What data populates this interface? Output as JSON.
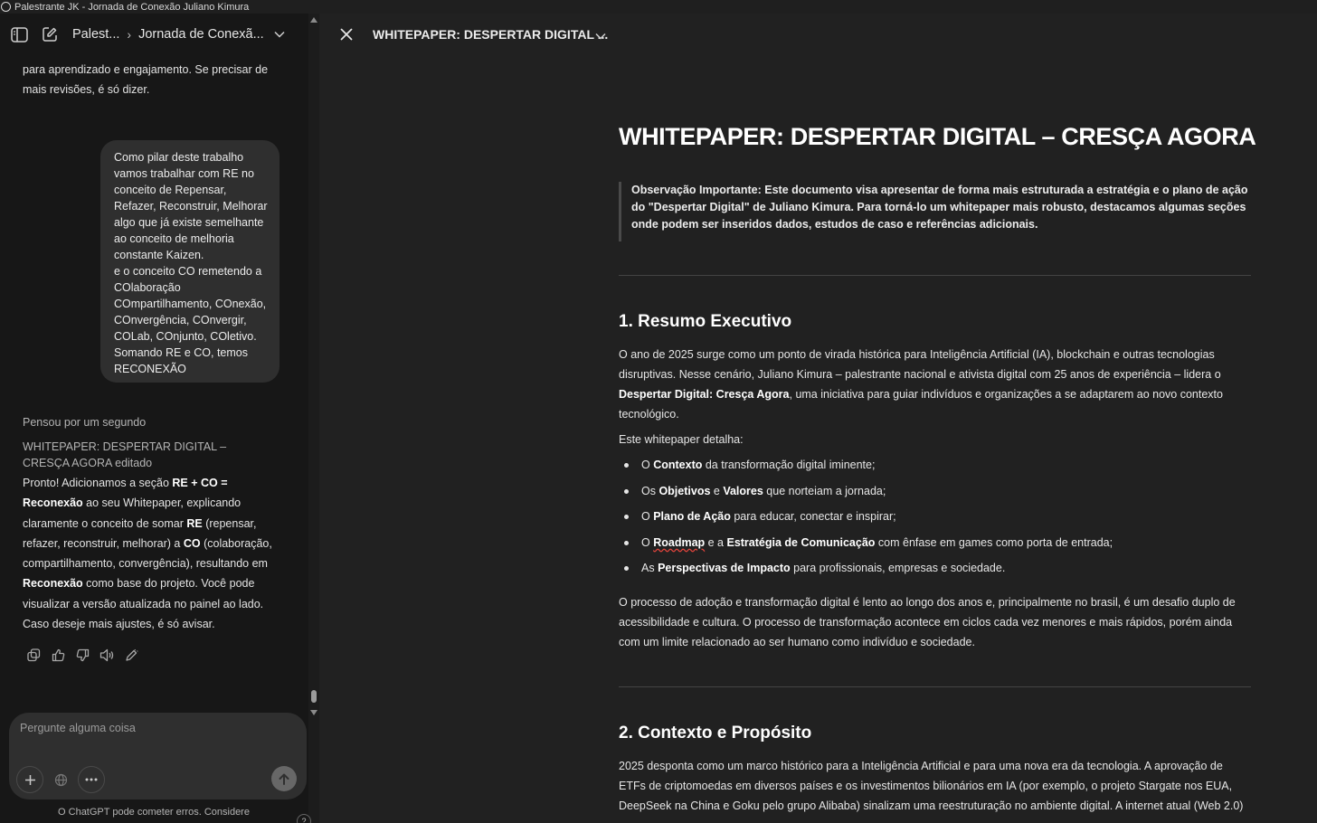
{
  "window": {
    "title": "Palestrante JK - Jornada de Conexão Juliano Kimura"
  },
  "left_header": {
    "crumb_project": "Palest...",
    "crumb_chat": "Jornada de Conexã..."
  },
  "chat": {
    "prev_ai_text": "para aprendizado e engajamento. Se precisar de mais revisões, é só dizer.",
    "user_message": "Como pilar deste trabalho vamos trabalhar com RE no conceito de Repensar, Refazer, Reconstruir, Melhorar algo que já existe semelhante ao conceito de melhoria constante Kaizen.\ne o conceito CO remetendo a COlaboração COmpartilhamento, COnexão, COnvergência, COnvergir, COLab, COnjunto, COletivo. Somando RE e CO, temos RECONEXÃO",
    "thought_label": "Pensou por um segundo",
    "edited_label": "WHITEPAPER: DESPERTAR DIGITAL – CRESÇA AGORA editado",
    "reply": {
      "t1": "Pronto! Adicionamos a seção ",
      "b1": "RE + CO = Reconexão",
      "t2": " ao seu Whitepaper, explicando claramente o conceito de somar ",
      "b2": "RE",
      "t3": " (repensar, refazer, reconstruir, melhorar) a ",
      "b3": "CO",
      "t4": " (colaboração, compartilhamento, convergência), resultando em ",
      "b4": "Reconexão",
      "t5": " como base do projeto. Você pode visualizar a versão atualizada no painel ao lado. Caso deseje mais ajustes, é só avisar."
    }
  },
  "composer": {
    "placeholder": "Pergunte alguma coisa",
    "disclaimer": "O ChatGPT pode cometer erros. Considere",
    "help": "?"
  },
  "document": {
    "header_title": "WHITEPAPER: DESPERTAR DIGITAL ...",
    "title": "WHITEPAPER: DESPERTAR DIGITAL – CRESÇA AGORA",
    "note": "Observação Importante: Este documento visa apresentar de forma mais estruturada a estratégia e o plano de ação do \"Despertar Digital\" de Juliano Kimura. Para torná-lo um whitepaper mais robusto, destacamos algumas seções onde podem ser inseridos dados, estudos de caso e referências adicionais.",
    "s1_heading": "1. Resumo Executivo",
    "s1_p1_a": "O ano de 2025 surge como um ponto de virada histórica para Inteligência Artificial (IA), blockchain e outras tecnologias disruptivas. Nesse cenário, Juliano Kimura – palestrante nacional e ativista digital com 25 anos de experiência – lidera o ",
    "s1_p1_b": "Despertar Digital: Cresça Agora",
    "s1_p1_c": ", uma iniciativa para guiar indivíduos e organizações a se adaptarem ao novo contexto tecnológico.",
    "s1_intro": "Este whitepaper detalha:",
    "bullets": [
      {
        "pre": "O ",
        "bold": "Contexto",
        "post": " da transformação digital iminente;"
      },
      {
        "pre": "Os ",
        "bold": "Objetivos",
        "mid": " e ",
        "bold2": "Valores",
        "post": " que norteiam a jornada;"
      },
      {
        "pre": "O ",
        "bold": "Plano de Ação",
        "post": " para educar, conectar e inspirar;"
      },
      {
        "pre": "O ",
        "bold": "Roadmap",
        "mid": " e a ",
        "bold2": "Estratégia de Comunicação",
        "post": " com ênfase em games como porta de entrada;"
      },
      {
        "pre": "As ",
        "bold": "Perspectivas de Impacto",
        "post": " para profissionais, empresas e sociedade."
      }
    ],
    "s1_p2": "O processo de adoção e transformação digital é lento ao longo dos anos e, principalmente no brasil, é um desafio duplo de acessibilidade e cultura. O processo de transformação acontece em ciclos cada vez menores e mais rápidos, porém ainda com um limite relacionado ao ser humano como indivíduo e sociedade.",
    "s2_heading": "2. Contexto e Propósito",
    "s2_p1": "2025 desponta como um marco histórico para a Inteligência Artificial e para uma nova era da tecnologia. A aprovação de ETFs de criptomoedas em diversos países e os investimentos bilionários em IA (por exemplo, o projeto Stargate nos EUA, DeepSeek na China e Goku pelo grupo Alibaba) sinalizam uma reestruturação no ambiente digital. A internet atual (Web 2.0)"
  }
}
